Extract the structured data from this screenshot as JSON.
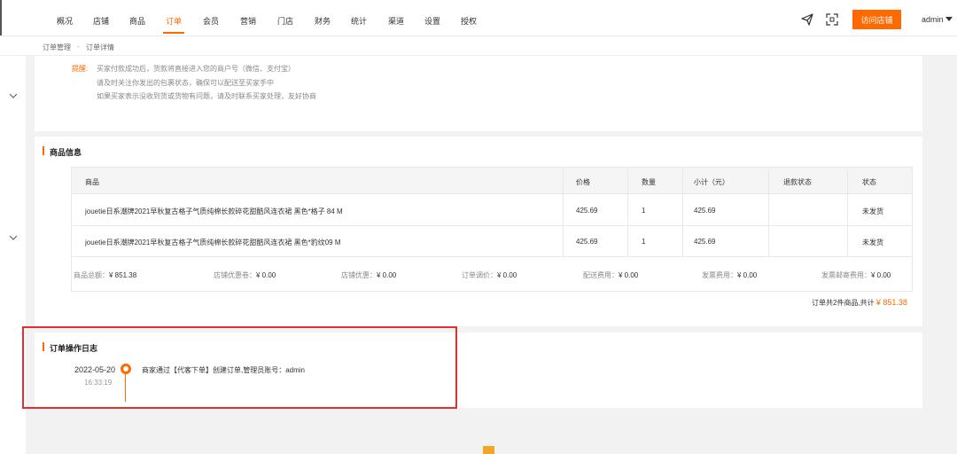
{
  "nav": {
    "items": [
      "概况",
      "店铺",
      "商品",
      "订单",
      "会员",
      "营销",
      "门店",
      "财务",
      "统计",
      "渠道",
      "设置",
      "授权"
    ],
    "active": "订单",
    "visit_button": "访问店铺",
    "user": "admin",
    "accent_color": "#ff6a00"
  },
  "breadcrumb": [
    "订单管理",
    "订单详情"
  ],
  "breadcrumb_sep": "-",
  "tip": {
    "label": "提醒:",
    "lines": [
      "买家付款成功后，货款将直接进入您的商户号（微信、支付宝）",
      "请及时关注你发出的包裹状态，确保可以配送至买家手中",
      "如果买家表示没收到货或货物有问题，请及时联系买家处理，友好协商"
    ]
  },
  "goods": {
    "title": "商品信息",
    "columns": [
      "商品",
      "价格",
      "数量",
      "小计（元）",
      "退款状态",
      "状态"
    ],
    "rows": [
      [
        "jouetie日系潮牌2021早秋复古格子气质纯棉长款碎花甜酷风连衣裙 黑色*格子 84 M",
        "425.69",
        "1",
        "425.69",
        "",
        "未发货"
      ],
      [
        "jouetie日系潮牌2021早秋复古格子气质纯棉长款碎花甜酷风连衣裙 黑色*豹纹09 M",
        "425.69",
        "1",
        "425.69",
        "",
        "未发货"
      ]
    ],
    "summary": [
      {
        "label": "商品总额：",
        "value": "¥ 851.38"
      },
      {
        "label": "店铺优惠卷：",
        "value": "¥ 0.00"
      },
      {
        "label": "店铺优惠：",
        "value": "¥ 0.00"
      },
      {
        "label": "订单调价：",
        "value": "¥ 0.00"
      },
      {
        "label": "配送费用：",
        "value": "¥ 0.00"
      },
      {
        "label": "发票费用：",
        "value": "¥ 0.00"
      },
      {
        "label": "发票邮寄费用：",
        "value": "¥ 0.00"
      }
    ],
    "total_prefix": "订单共2件商品,共计",
    "total_value": "¥ 851.38"
  },
  "log": {
    "title": "订单操作日志",
    "entries": [
      {
        "date": "2022-05-20",
        "time": "16:33:19",
        "text": "商家通过【代客下单】创建订单,管理员账号：admin"
      }
    ]
  }
}
